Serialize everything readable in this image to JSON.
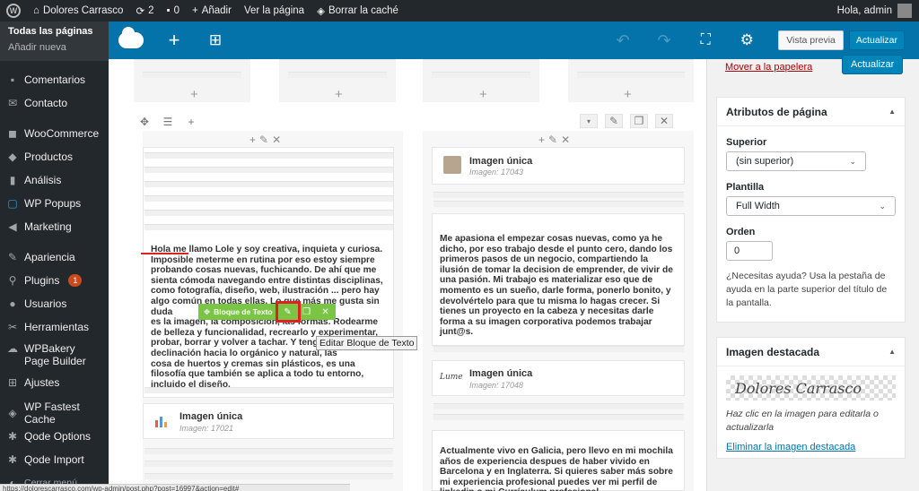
{
  "adminbar": {
    "site_name": "Dolores Carrasco",
    "updates_count": "2",
    "comments_count": "0",
    "new_label": "Añadir",
    "view_page": "Ver la página",
    "clear_cache": "Borrar la caché",
    "greeting": "Hola, admin"
  },
  "sidebar": {
    "sub_items": [
      {
        "label": "Todas las páginas",
        "current": true
      },
      {
        "label": "Añadir nueva",
        "current": false
      }
    ],
    "items": [
      {
        "label": "Comentarios",
        "icon": "comment-icon"
      },
      {
        "label": "Contacto",
        "icon": "mail-icon"
      },
      {
        "label": "WooCommerce",
        "icon": "woo-icon"
      },
      {
        "label": "Productos",
        "icon": "box-icon"
      },
      {
        "label": "Análisis",
        "icon": "bar-chart-icon"
      },
      {
        "label": "WP Popups",
        "icon": "popup-icon"
      },
      {
        "label": "Marketing",
        "icon": "megaphone-icon"
      },
      {
        "label": "Apariencia",
        "icon": "brush-icon"
      },
      {
        "label": "Plugins",
        "icon": "plug-icon",
        "badge": "1"
      },
      {
        "label": "Usuarios",
        "icon": "user-icon"
      },
      {
        "label": "Herramientas",
        "icon": "wrench-icon"
      },
      {
        "label": "WPBakery Page Builder",
        "icon": "cloud-icon"
      },
      {
        "label": "Ajustes",
        "icon": "settings-icon"
      },
      {
        "label": "WP Fastest Cache",
        "icon": "cache-icon"
      },
      {
        "label": "Qode Options",
        "icon": "gear-icon"
      },
      {
        "label": "Qode Import",
        "icon": "gear-icon"
      }
    ],
    "collapse": "Cerrar menú"
  },
  "vcbar": {
    "preview": "Vista previa",
    "update": "Actualizar"
  },
  "canvas": {
    "toolbar_name": "Bloque de Texto",
    "tooltip": "Editar Bloque de Texto",
    "left_text": "Hola me llamo Lole y soy creativa, inquieta y curiosa.\nImposible meterme en rutina por eso estoy siempre\nprobando cosas nuevas, fuchicando. De ahí que me\nsienta cómoda navegando entre distintas disciplinas,\ncomo fotografía, diseño, web, ilustración ... pero hay\nalgo común en todas ellas. Lo que más me gusta sin duda\nes la imagen, la composición, las formas. Rodearme\nde belleza y funcionalidad, recrearlo y experimentar,\nprobar, borrar y volver a tachar. Y tengo especial\ndeclinación hacia lo orgánico y natural, las\ncosa de huertos y cremas sin plásticos, es una\nfilosofía que también se aplica a todo tu entorno,\nincluido el diseño.",
    "left_image": {
      "title": "Imagen única",
      "sub": "Imagen: 17021"
    },
    "right_image1": {
      "title": "Imagen única",
      "sub": "Imagen: 17043"
    },
    "right_text1": "Me apasiona el empezar cosas nuevas, como ya he\ndicho, por eso trabajo desde el punto cero, dando los\nprimeros pasos de un negocio, compartiendo la\nilusión de tomar la decision de emprender, de vivir de\nuna pasión. Mi trabajo es materializar eso que de\nmomento es un sueño, darle forma, ponerlo bonito, y\ndevolvértelo para que tu misma lo hagas crecer. Si\ntienes un proyecto en la cabeza y necesitas darle\nforma a su imagen corporativa podemos trabajar\njunt@s.",
    "right_image2": {
      "title": "Imagen única",
      "sub": "Imagen: 17048"
    },
    "right_text2": "Actualmente vivo en Galicia, pero llevo en mi mochila\naños de experiencia despues de haber vivido en\nBarcelona y en Inglaterra.  Si quieres saber más sobre\nmi experiencia profesional puedes ver mi perfil de\nlinkedin o mi Currículum profesional.",
    "sig_thumb": "Lume"
  },
  "right_panel": {
    "trash_link": "Mover a la papelera",
    "publish_btn": "Actualizar",
    "attributes": {
      "title": "Atributos de página",
      "parent_label": "Superior",
      "parent_value": "(sin superior)",
      "template_label": "Plantilla",
      "template_value": "Full Width",
      "order_label": "Orden",
      "order_value": "0",
      "help": "¿Necesitas ayuda? Usa la pestaña de ayuda en la parte superior del título de la pantalla."
    },
    "featured": {
      "title": "Imagen destacada",
      "signature": "Dolores Carrasco",
      "help": "Haz clic en la imagen para editarla o actualizarla",
      "remove": "Eliminar la imagen destacada"
    }
  },
  "statusbar": "https://dolorescarrasco.com/wp-admin/post.php?post=16997&action=edit#"
}
